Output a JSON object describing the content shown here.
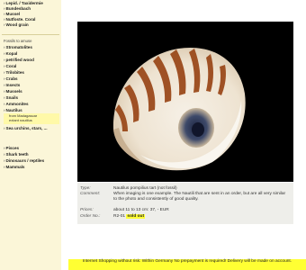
{
  "sidebar": {
    "top_items": [
      {
        "label": "Lepid. / Taxidermie"
      },
      {
        "label": "Bundesbach"
      },
      {
        "label": "Mussel"
      },
      {
        "label": "Nutfoste. Coral"
      },
      {
        "label": "Wood grain"
      }
    ],
    "section_title": "Fossils to amuse",
    "items": [
      {
        "label": "Stromatolites"
      },
      {
        "label": "Kopal"
      },
      {
        "label": "petrified wood"
      },
      {
        "label": "Coral"
      },
      {
        "label": "Trilobites"
      },
      {
        "label": "Crabs"
      },
      {
        "label": "Insects"
      },
      {
        "label": "Mussels"
      },
      {
        "label": "Snails"
      },
      {
        "label": "Ammonites"
      },
      {
        "label": "Nautilus"
      }
    ],
    "subitems": [
      {
        "label": "from Madagascar"
      },
      {
        "label": "extant nautilus"
      }
    ],
    "after_items": [
      {
        "label": "Sea urchins, stars, ..."
      },
      {
        "label": "Pisces"
      },
      {
        "label": "Shark teeth"
      },
      {
        "label": "Dinosaurs / reptiles"
      },
      {
        "label": "Mammals"
      }
    ]
  },
  "product": {
    "type_label": "Type:",
    "type_value": "Nautilus pompilius tart (not fossil)",
    "comment_label": "Comment:",
    "comment_value": "When imaging is one example. The Nautili that are sent in an order, but are all very similar to the photo and consistently of good quality.",
    "prices_label": "Prices:",
    "prices_value": "about 11 to 13 cm: 37, - EUR",
    "order_label": "Order No.:",
    "order_value": "R2-01",
    "status": "sold out"
  },
  "banner": {
    "text": "Internet Shopping without risk: Within Germany No prepayment is required! Delivery will be made on account."
  },
  "colors": {
    "sidebar_bg": "#fbf6d8",
    "highlight": "#ffff33",
    "photo_bg": "#000000",
    "info_bg": "#eeeeea"
  }
}
